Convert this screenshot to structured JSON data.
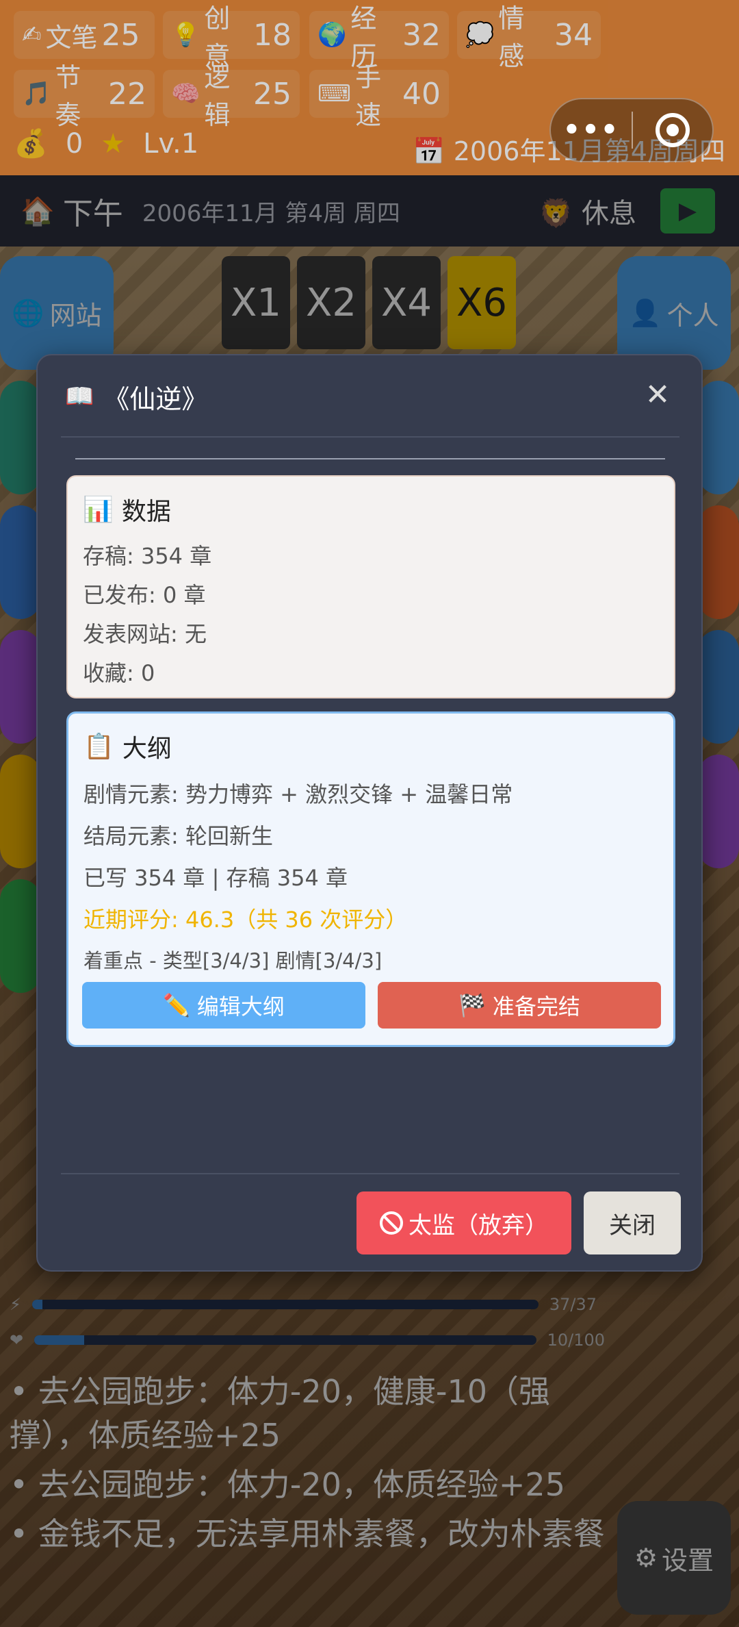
{
  "stats": [
    {
      "icon": "✍",
      "label": "文笔",
      "value": "25"
    },
    {
      "icon": "💡",
      "label": "创意",
      "value": "18"
    },
    {
      "icon": "🌍",
      "label": "经历",
      "value": "32"
    },
    {
      "icon": "💭",
      "label": "情感",
      "value": "34"
    },
    {
      "icon": "🎵",
      "label": "节奏",
      "value": "22"
    },
    {
      "icon": "🧠",
      "label": "逻辑",
      "value": "25"
    },
    {
      "icon": "⌨",
      "label": "手速",
      "value": "40"
    }
  ],
  "money": {
    "icon": "💰",
    "value": "0"
  },
  "level": {
    "icon": "★",
    "value": "Lv.1"
  },
  "top_date": {
    "icon": "📅",
    "value": "2006年11月第4周周四"
  },
  "capsule": {
    "more_label": "•••"
  },
  "timebar": {
    "period": "下午",
    "date": "2006年11月 第4周 周四",
    "rest_label": "休息",
    "play_icon": "▶"
  },
  "speeds": [
    "X1",
    "X2",
    "X4",
    "X6"
  ],
  "left_buttons": {
    "website": "网站"
  },
  "right_buttons": {
    "personal": "个人",
    "settings": "设置"
  },
  "status_values": [
    "37/37",
    "10/100"
  ],
  "status_fill": [
    0.02,
    0.1
  ],
  "log": [
    "• 去公园跑步：体力-20，健康-10（强撑），体质经验+25",
    "• 去公园跑步：体力-20，体质经验+25",
    "• 金钱不足，无法享用朴素餐，改为朴素餐"
  ],
  "modal": {
    "title": "《仙逆》",
    "close_symbol": "✕",
    "data_card": {
      "title": "数据",
      "lines": [
        "存稿: 354 章",
        "已发布: 0 章",
        "发表网站: 无",
        "收藏: 0"
      ]
    },
    "outline_card": {
      "title": "大纲",
      "plot": "剧情元素: 势力博弈 + 激烈交锋 + 温馨日常",
      "ending": "结局元素: 轮回新生",
      "progress": "已写 354 章 | 存稿 354 章",
      "score": "近期评分: 46.3（共 36 次评分）",
      "focus": "着重点 - 类型[3/4/3] 剧情[3/4/3]",
      "edit_label": "编辑大纲",
      "finish_label": "准备完结"
    },
    "abandon_label": "太监（放弃）",
    "close_label": "关闭"
  },
  "colors": {
    "accent_blue": "#5fb0f7",
    "finish_red": "#e06252",
    "abandon_red": "#f2525a",
    "score_yellow": "#f0b400",
    "modal_bg": "#363c4e"
  }
}
